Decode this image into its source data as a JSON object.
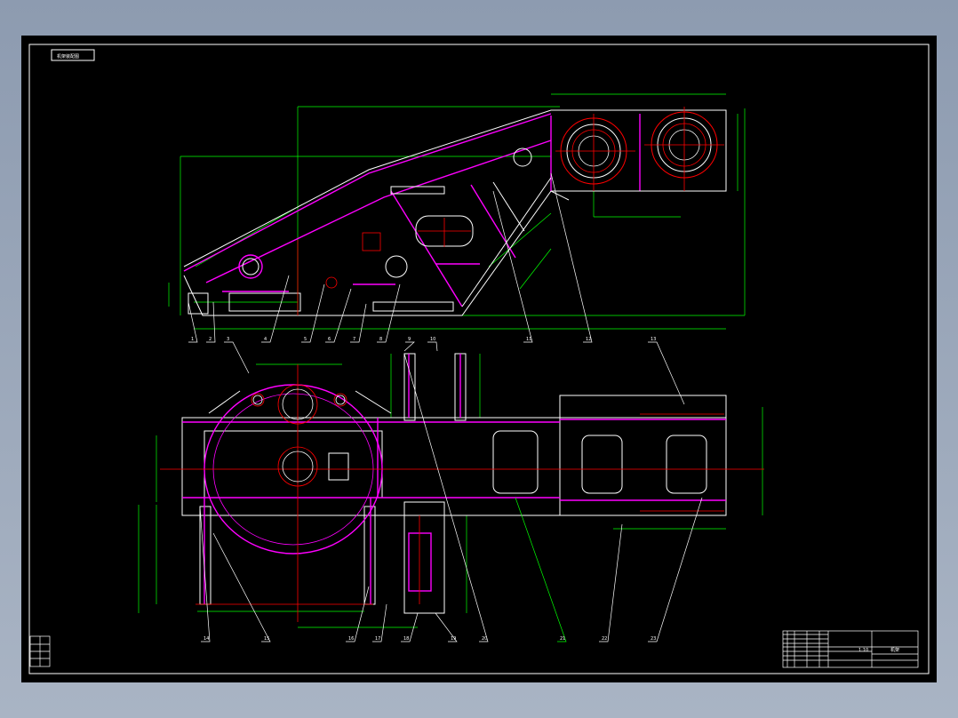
{
  "drawing": {
    "title_label": "机架装配图",
    "colors": {
      "background": "#000000",
      "frame": "#ffffff",
      "outline": "#ffffff",
      "weld": "#ff00ff",
      "centerline": "#ff0000",
      "dimension": "#00ff00"
    }
  },
  "balloons_top": [
    "1",
    "2",
    "3",
    "4",
    "5",
    "6",
    "7",
    "8",
    "9",
    "10",
    "11",
    "12",
    "13"
  ],
  "balloons_bottom": [
    "14",
    "15",
    "16",
    "17",
    "18",
    "19",
    "20",
    "21",
    "22",
    "23"
  ],
  "title_block": {
    "drawing_name": "机架",
    "scale": "1:10"
  }
}
